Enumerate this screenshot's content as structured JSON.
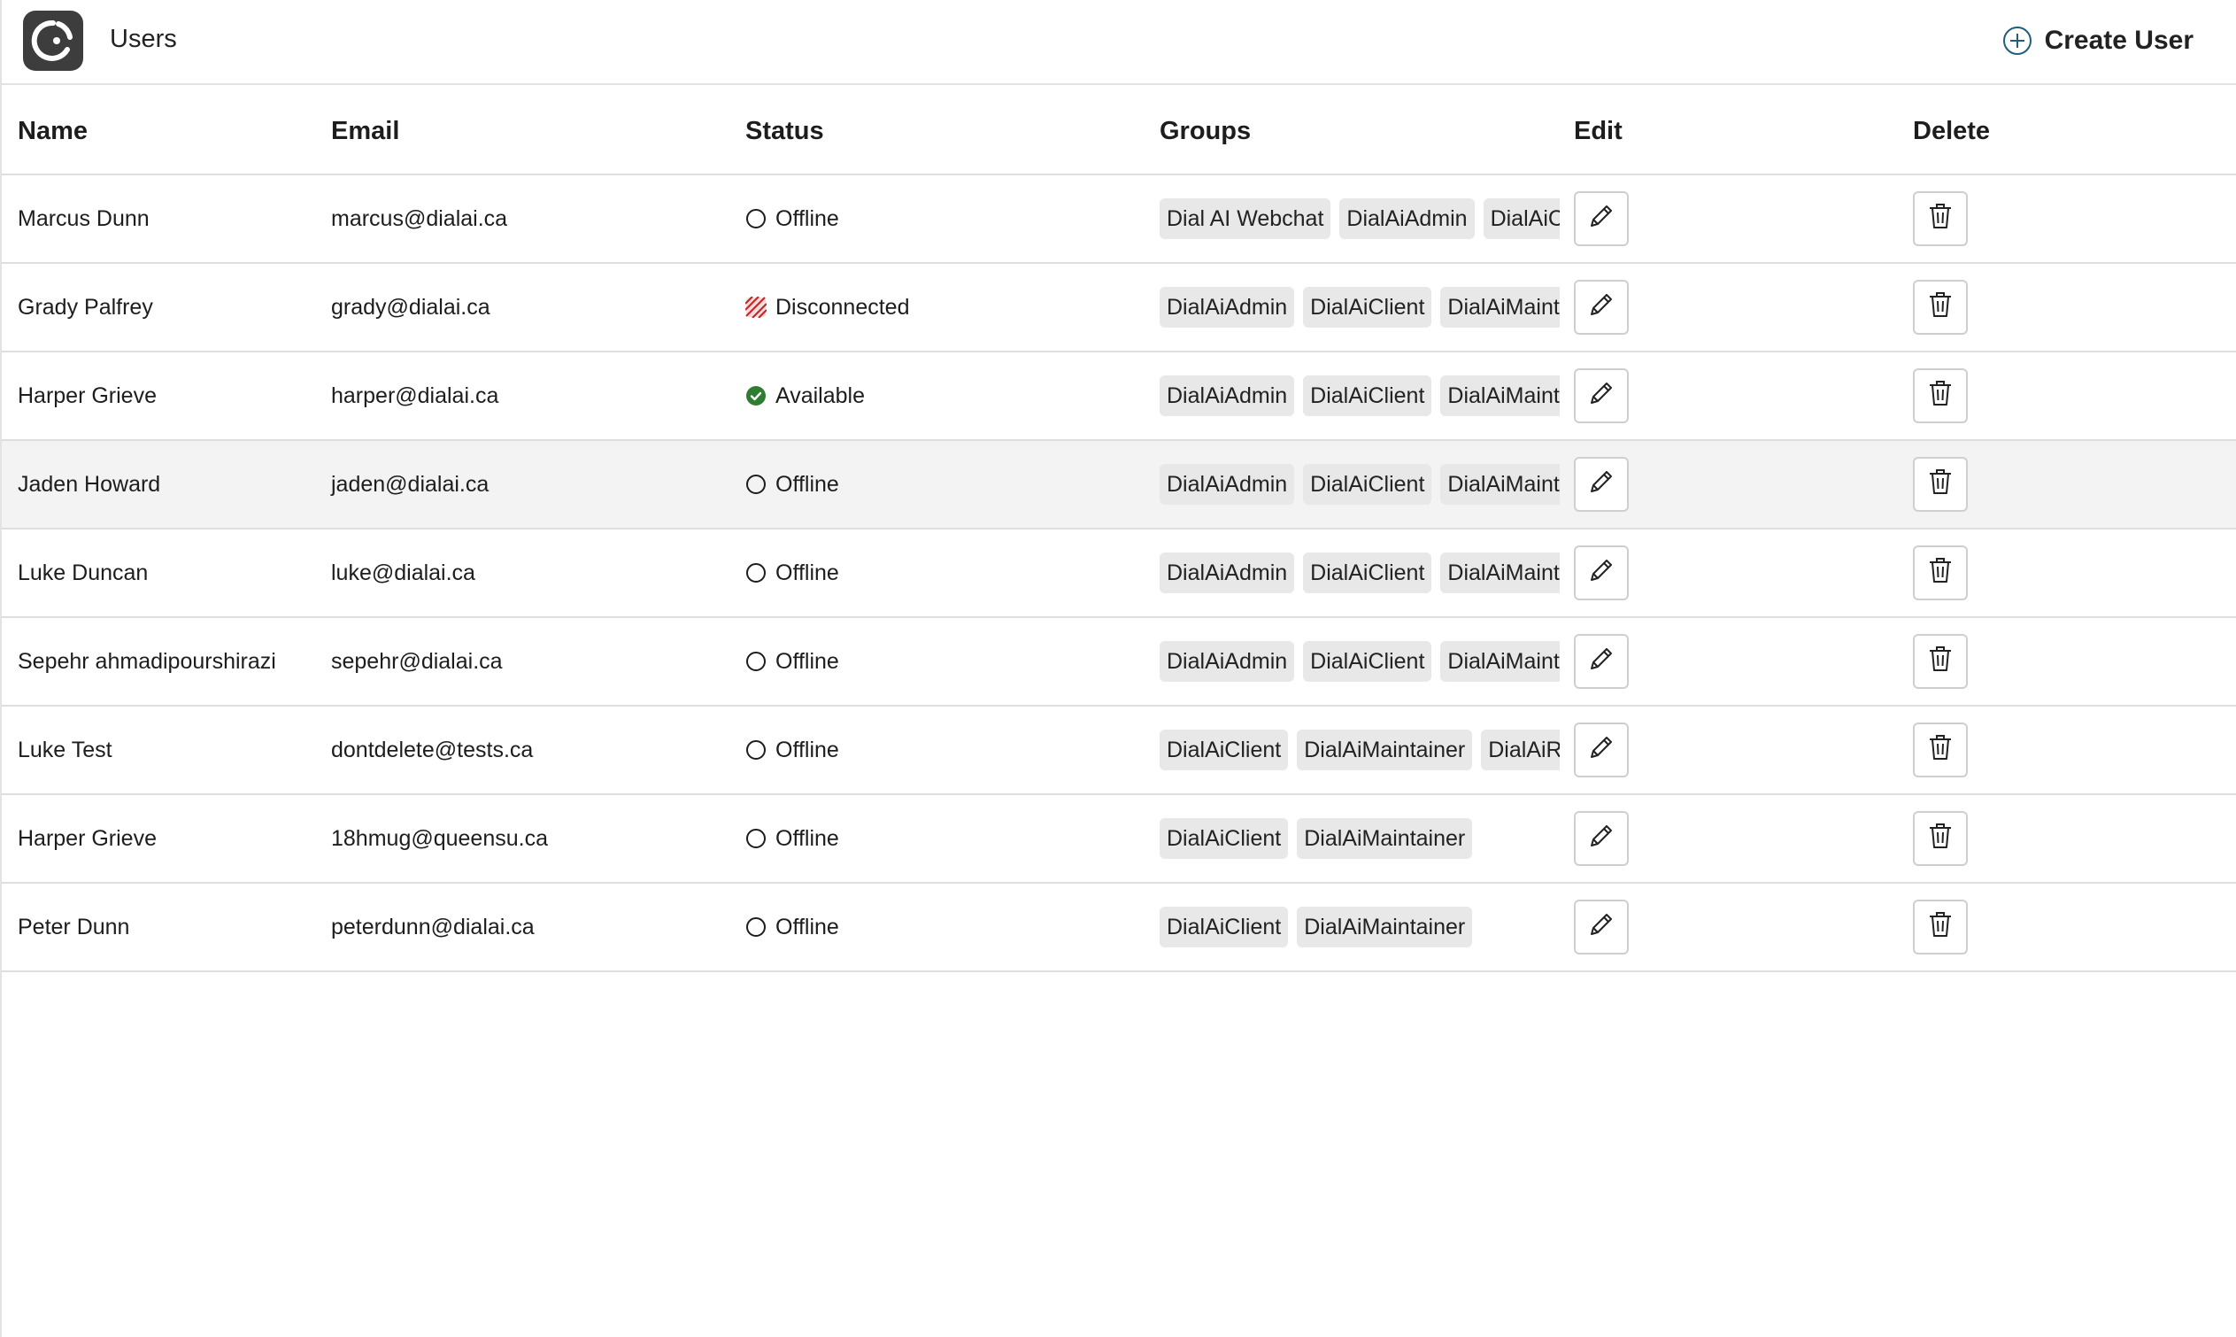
{
  "header": {
    "title": "Users",
    "create_label": "Create User"
  },
  "columns": [
    "Name",
    "Email",
    "Status",
    "Groups",
    "Edit",
    "Delete"
  ],
  "users": [
    {
      "name": "Marcus Dunn",
      "email": "marcus@dialai.ca",
      "status": "Offline",
      "status_kind": "offline",
      "groups": [
        "Dial AI Webchat",
        "DialAiAdmin",
        "DialAiClient"
      ]
    },
    {
      "name": "Grady Palfrey",
      "email": "grady@dialai.ca",
      "status": "Disconnected",
      "status_kind": "disconnected",
      "groups": [
        "DialAiAdmin",
        "DialAiClient",
        "DialAiMaintainer"
      ]
    },
    {
      "name": "Harper Grieve",
      "email": "harper@dialai.ca",
      "status": "Available",
      "status_kind": "available",
      "groups": [
        "DialAiAdmin",
        "DialAiClient",
        "DialAiMaintainer"
      ]
    },
    {
      "name": "Jaden Howard",
      "email": "jaden@dialai.ca",
      "status": "Offline",
      "status_kind": "offline",
      "groups": [
        "DialAiAdmin",
        "DialAiClient",
        "DialAiMaintainer"
      ]
    },
    {
      "name": "Luke Duncan",
      "email": "luke@dialai.ca",
      "status": "Offline",
      "status_kind": "offline",
      "groups": [
        "DialAiAdmin",
        "DialAiClient",
        "DialAiMaintainer"
      ]
    },
    {
      "name": "Sepehr ahmadipourshirazi",
      "email": "sepehr@dialai.ca",
      "status": "Offline",
      "status_kind": "offline",
      "groups": [
        "DialAiAdmin",
        "DialAiClient",
        "DialAiMaintainer"
      ]
    },
    {
      "name": "Luke Test",
      "email": "dontdelete@tests.ca",
      "status": "Offline",
      "status_kind": "offline",
      "groups": [
        "DialAiClient",
        "DialAiMaintainer",
        "DialAiR"
      ]
    },
    {
      "name": "Harper Grieve",
      "email": "18hmug@queensu.ca",
      "status": "Offline",
      "status_kind": "offline",
      "groups": [
        "DialAiClient",
        "DialAiMaintainer"
      ]
    },
    {
      "name": "Peter Dunn",
      "email": "peterdunn@dialai.ca",
      "status": "Offline",
      "status_kind": "offline",
      "groups": [
        "DialAiClient",
        "DialAiMaintainer"
      ]
    }
  ],
  "highlighted_row": 3,
  "colors": {
    "available": "#2e7d32",
    "disconnected": "#c62828",
    "accent": "#1f5f7a"
  }
}
